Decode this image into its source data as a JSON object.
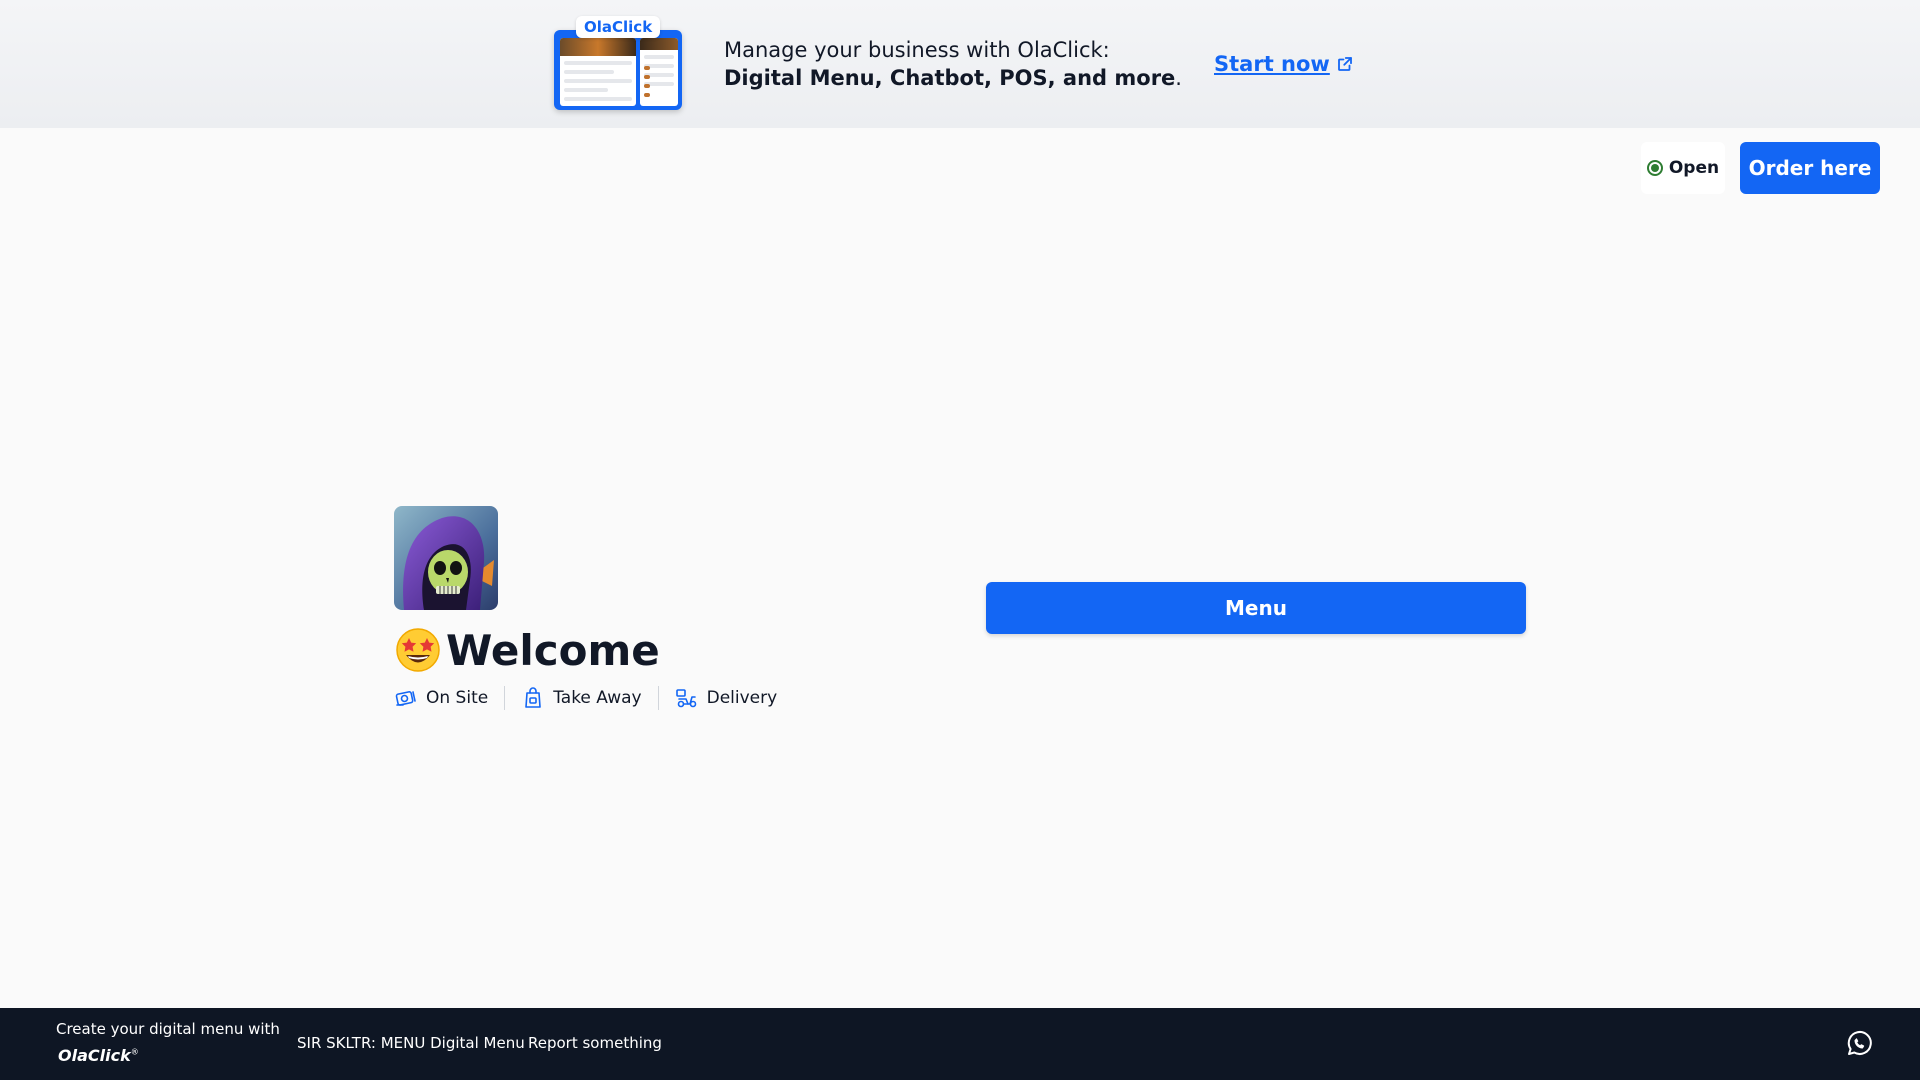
{
  "banner": {
    "brand_tag": "OlaClick",
    "text_plain": "Manage your business with OlaClick: ",
    "text_bold": "Digital Menu, Chatbot, POS, and more",
    "text_end": ".",
    "cta_label": "Start now",
    "cta_icon": "external-link-icon"
  },
  "header": {
    "status_label": "Open",
    "status_color": "#2e7d32",
    "order_label": "Order here"
  },
  "store": {
    "welcome_emoji": "star-struck-emoji",
    "welcome_title": "Welcome",
    "services": [
      {
        "label": "On Site",
        "icon": "dine-in-icon"
      },
      {
        "label": "Take Away",
        "icon": "takeaway-bag-icon"
      },
      {
        "label": "Delivery",
        "icon": "scooter-icon"
      }
    ],
    "menu_label": "Menu"
  },
  "footer": {
    "create_text": "Create your digital menu with",
    "brand": "OlaClick",
    "brand_mark": "®",
    "menu_link": "SIR SKLTR: MENU Digital Menu",
    "report_link": "Report something",
    "chat_icon": "whatsapp-icon"
  },
  "theme": {
    "accent": "#1366f4",
    "footer_bg": "#0e1624",
    "page_bg": "#fafafa"
  }
}
